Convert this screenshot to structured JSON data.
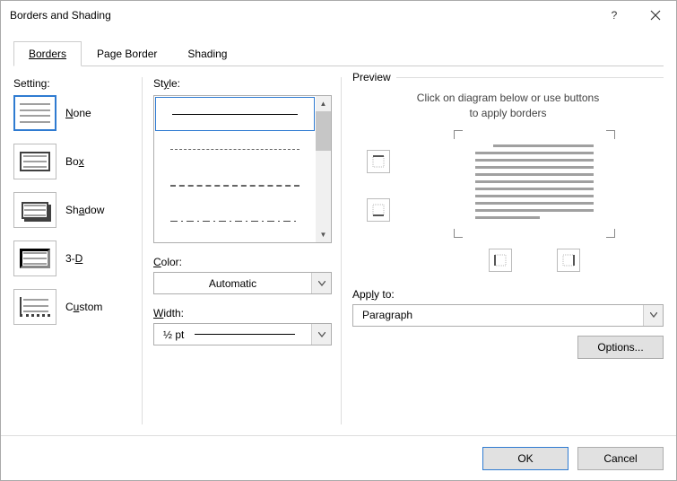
{
  "title": "Borders and Shading",
  "tabs": {
    "borders": "Borders",
    "page_border": "Page Border",
    "shading": "Shading"
  },
  "settings": {
    "label": "Setting:",
    "none": "None",
    "box": "Box",
    "shadow": "Shadow",
    "threed": "3-D",
    "custom": "Custom"
  },
  "style": {
    "label": "Style:",
    "color_label": "Color:",
    "color_value": "Automatic",
    "width_label": "Width:",
    "width_value": "½ pt"
  },
  "preview": {
    "legend": "Preview",
    "hint_line1": "Click on diagram below or use buttons",
    "hint_line2": "to apply borders",
    "apply_label": "Apply to:",
    "apply_value": "Paragraph",
    "options": "Options..."
  },
  "footer": {
    "ok": "OK",
    "cancel": "Cancel"
  }
}
